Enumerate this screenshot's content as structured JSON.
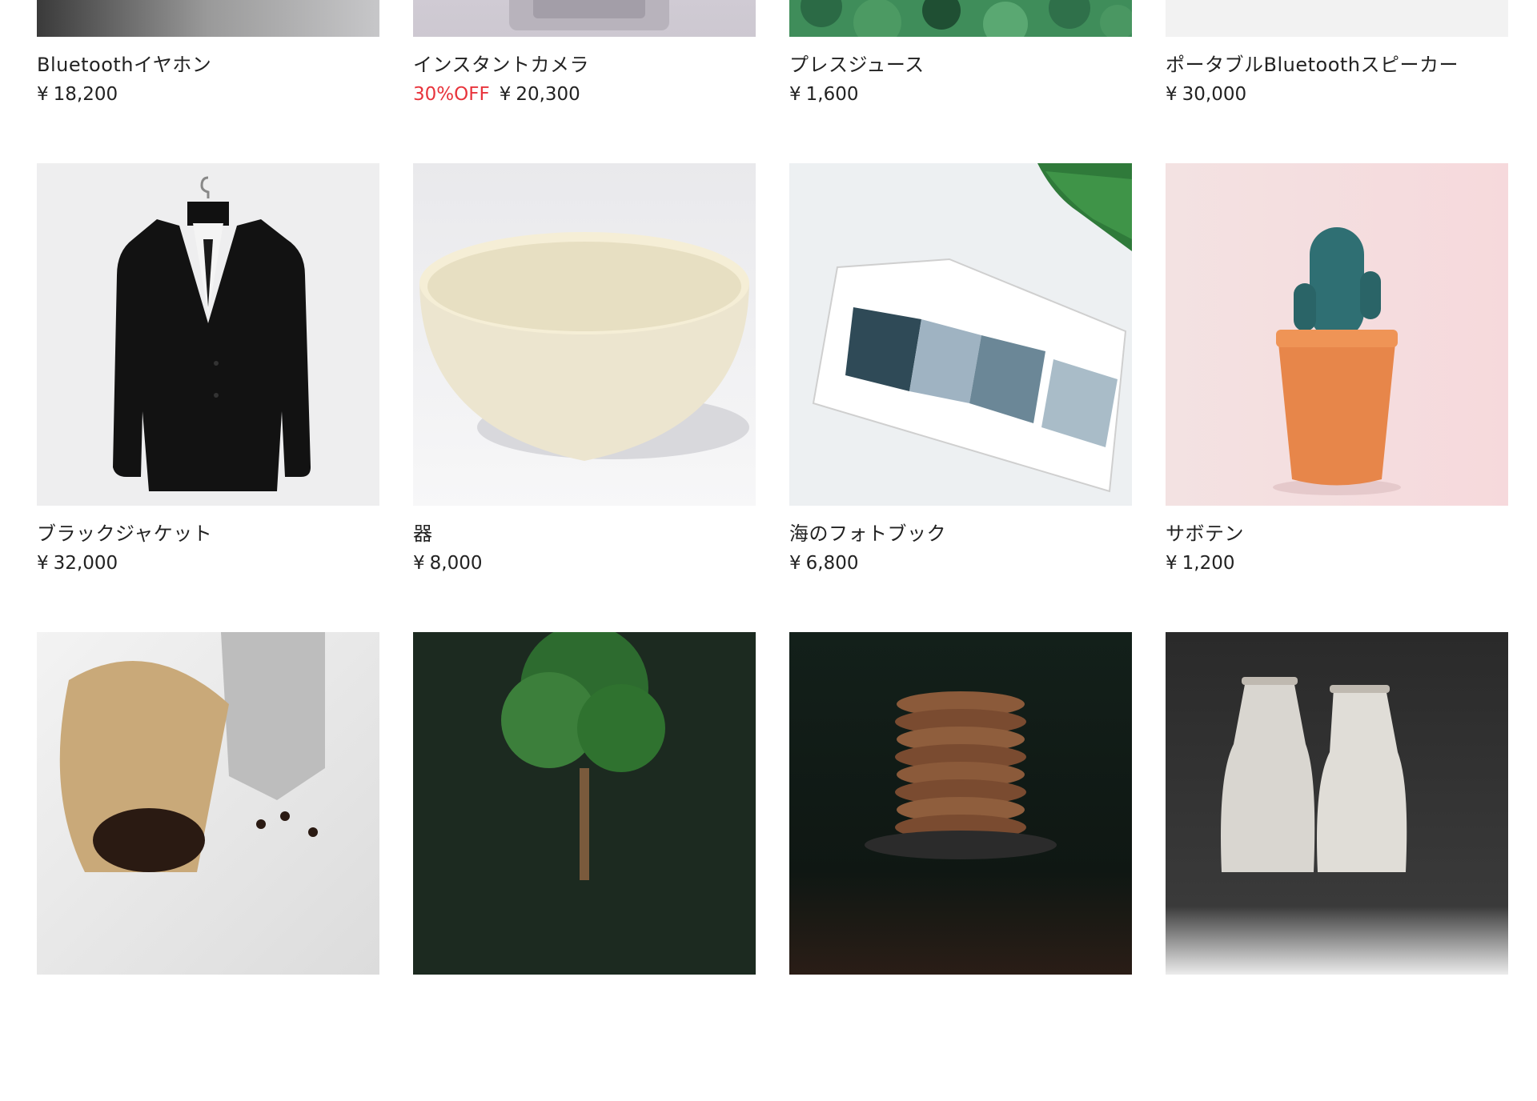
{
  "products": [
    {
      "title": "Bluetoothイヤホン",
      "price": "18,200",
      "discount": ""
    },
    {
      "title": "インスタントカメラ",
      "price": "20,300",
      "discount": "30%OFF"
    },
    {
      "title": "プレスジュース",
      "price": "1,600",
      "discount": ""
    },
    {
      "title": "ポータブルBluetoothスピーカー",
      "price": "30,000",
      "discount": ""
    },
    {
      "title": "ブラックジャケット",
      "price": "32,000",
      "discount": ""
    },
    {
      "title": "器",
      "price": "8,000",
      "discount": ""
    },
    {
      "title": "海のフォトブック",
      "price": "6,800",
      "discount": ""
    },
    {
      "title": "サボテン",
      "price": "1,200",
      "discount": ""
    },
    {
      "title": "",
      "price": "",
      "discount": ""
    },
    {
      "title": "",
      "price": "",
      "discount": ""
    },
    {
      "title": "",
      "price": "",
      "discount": ""
    },
    {
      "title": "",
      "price": "",
      "discount": ""
    }
  ],
  "currency_symbol": "¥",
  "colors": {
    "discount": "#e8343c"
  }
}
